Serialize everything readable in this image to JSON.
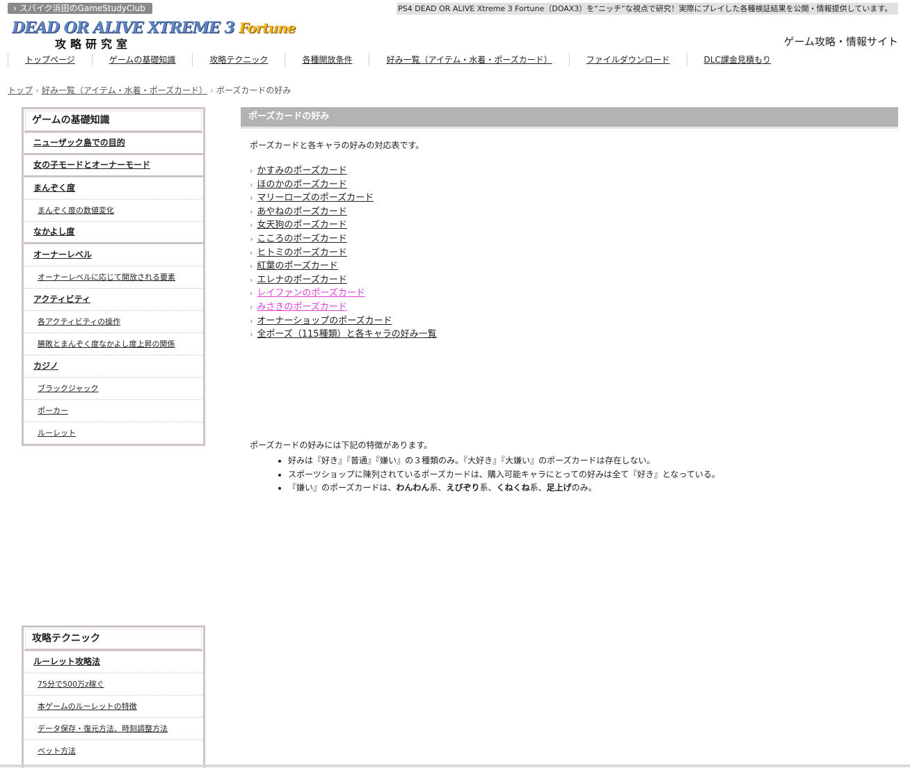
{
  "topbar": {
    "club": "スパイク浜田のGameStudyClub",
    "description": "PS4 DEAD OR ALIVE Xtreme 3 Fortune（DOAX3）を“ニッチ”な視点で研究！実際にプレイした各種検証結果を公開・情報提供しています。"
  },
  "logo": {
    "line1": "DEAD OR ALIVE XTREME 3",
    "fortune": "Fortune",
    "line2": "攻略研究室"
  },
  "site_type": "ゲーム攻略・情報サイト",
  "nav": [
    "トップページ",
    "ゲームの基礎知識",
    "攻略テクニック",
    "各種開放条件",
    "好み一覧（アイテム・水着・ポーズカード）",
    "ファイルダウンロード",
    "DLC課金見積もり"
  ],
  "breadcrumb": {
    "top": "トップ",
    "parent": "好み一覧（アイテム・水着・ポーズカード）",
    "current": "ポーズカードの好み"
  },
  "sidebar1": {
    "title": "ゲームの基礎知識",
    "items": [
      {
        "label": "ニューザック島での目的",
        "level": 1
      },
      {
        "label": "女の子モードとオーナーモード",
        "level": 1
      },
      {
        "label": "まんぞく度",
        "level": 1
      },
      {
        "label": "まんぞく度の数値変化",
        "level": 2
      },
      {
        "label": "なかよし度",
        "level": 1
      },
      {
        "label": "オーナーレベル",
        "level": 1
      },
      {
        "label": "オーナーレベルに応じて開放される要素",
        "level": 2
      },
      {
        "label": "アクティビティ",
        "level": 1
      },
      {
        "label": "各アクティビティの操作",
        "level": 2
      },
      {
        "label": "勝敗とまんぞく度なかよし度上昇の関係",
        "level": 2
      },
      {
        "label": "カジノ",
        "level": 1
      },
      {
        "label": "ブラックジャック",
        "level": 2
      },
      {
        "label": "ポーカー",
        "level": 2
      },
      {
        "label": "ルーレット",
        "level": 2
      }
    ]
  },
  "sidebar2": {
    "title": "攻略テクニック",
    "items": [
      {
        "label": "ルーレット攻略法",
        "level": 1
      },
      {
        "label": "75分で500万z稼ぐ",
        "level": 2
      },
      {
        "label": "本ゲームのルーレットの特徴",
        "level": 2
      },
      {
        "label": "データ保存・復元方法、時刻調整方法",
        "level": 2
      },
      {
        "label": "ベット方法",
        "level": 2
      }
    ]
  },
  "main": {
    "title": "ポーズカードの好み",
    "intro": "ポーズカードと各キャラの好みの対応表です。",
    "links": [
      {
        "label": "かすみのポーズカード",
        "visited": false
      },
      {
        "label": "ほのかのポーズカード",
        "visited": false
      },
      {
        "label": "マリーローズのポーズカード",
        "visited": false
      },
      {
        "label": "あやねのポーズカード",
        "visited": false
      },
      {
        "label": "女天狗のポーズカード",
        "visited": false
      },
      {
        "label": "こころのポーズカード",
        "visited": false
      },
      {
        "label": "ヒトミのポーズカード",
        "visited": false
      },
      {
        "label": "紅葉のポーズカード",
        "visited": false
      },
      {
        "label": "エレナのポーズカード",
        "visited": false
      },
      {
        "label": "レイファンのポーズカード",
        "visited": true
      },
      {
        "label": "みさきのポーズカード",
        "visited": true
      },
      {
        "label": "オーナーショップのポーズカード",
        "visited": false
      },
      {
        "label": "全ポーズ（115種類）と各キャラの好み一覧",
        "visited": false
      }
    ],
    "features_intro": "ポーズカードの好みには下記の特徴があります。",
    "feature1": "好みは『好き』『普通』『嫌い』の３種類のみ。『大好き』『大嫌い』のポーズカードは存在しない。",
    "feature2": "スポーツショップに陳列されているポーズカードは、購入可能キャラにとっての好みは全て『好き』となっている。",
    "feature3": {
      "pre": "『嫌い』のポーズカードは、",
      "b1": "わんわん",
      "t1": "系、",
      "b2": "えびぞり",
      "t2": "系、",
      "b3": "くねくね",
      "t3": "系、",
      "b4": "足上げ",
      "t4": "のみ。"
    }
  },
  "colors": {
    "visited_link": "#e040d8",
    "header_bar": "#b3b3b3",
    "sidebar_border": "#cfc4c4",
    "club_tag": "#8a8a8a"
  }
}
